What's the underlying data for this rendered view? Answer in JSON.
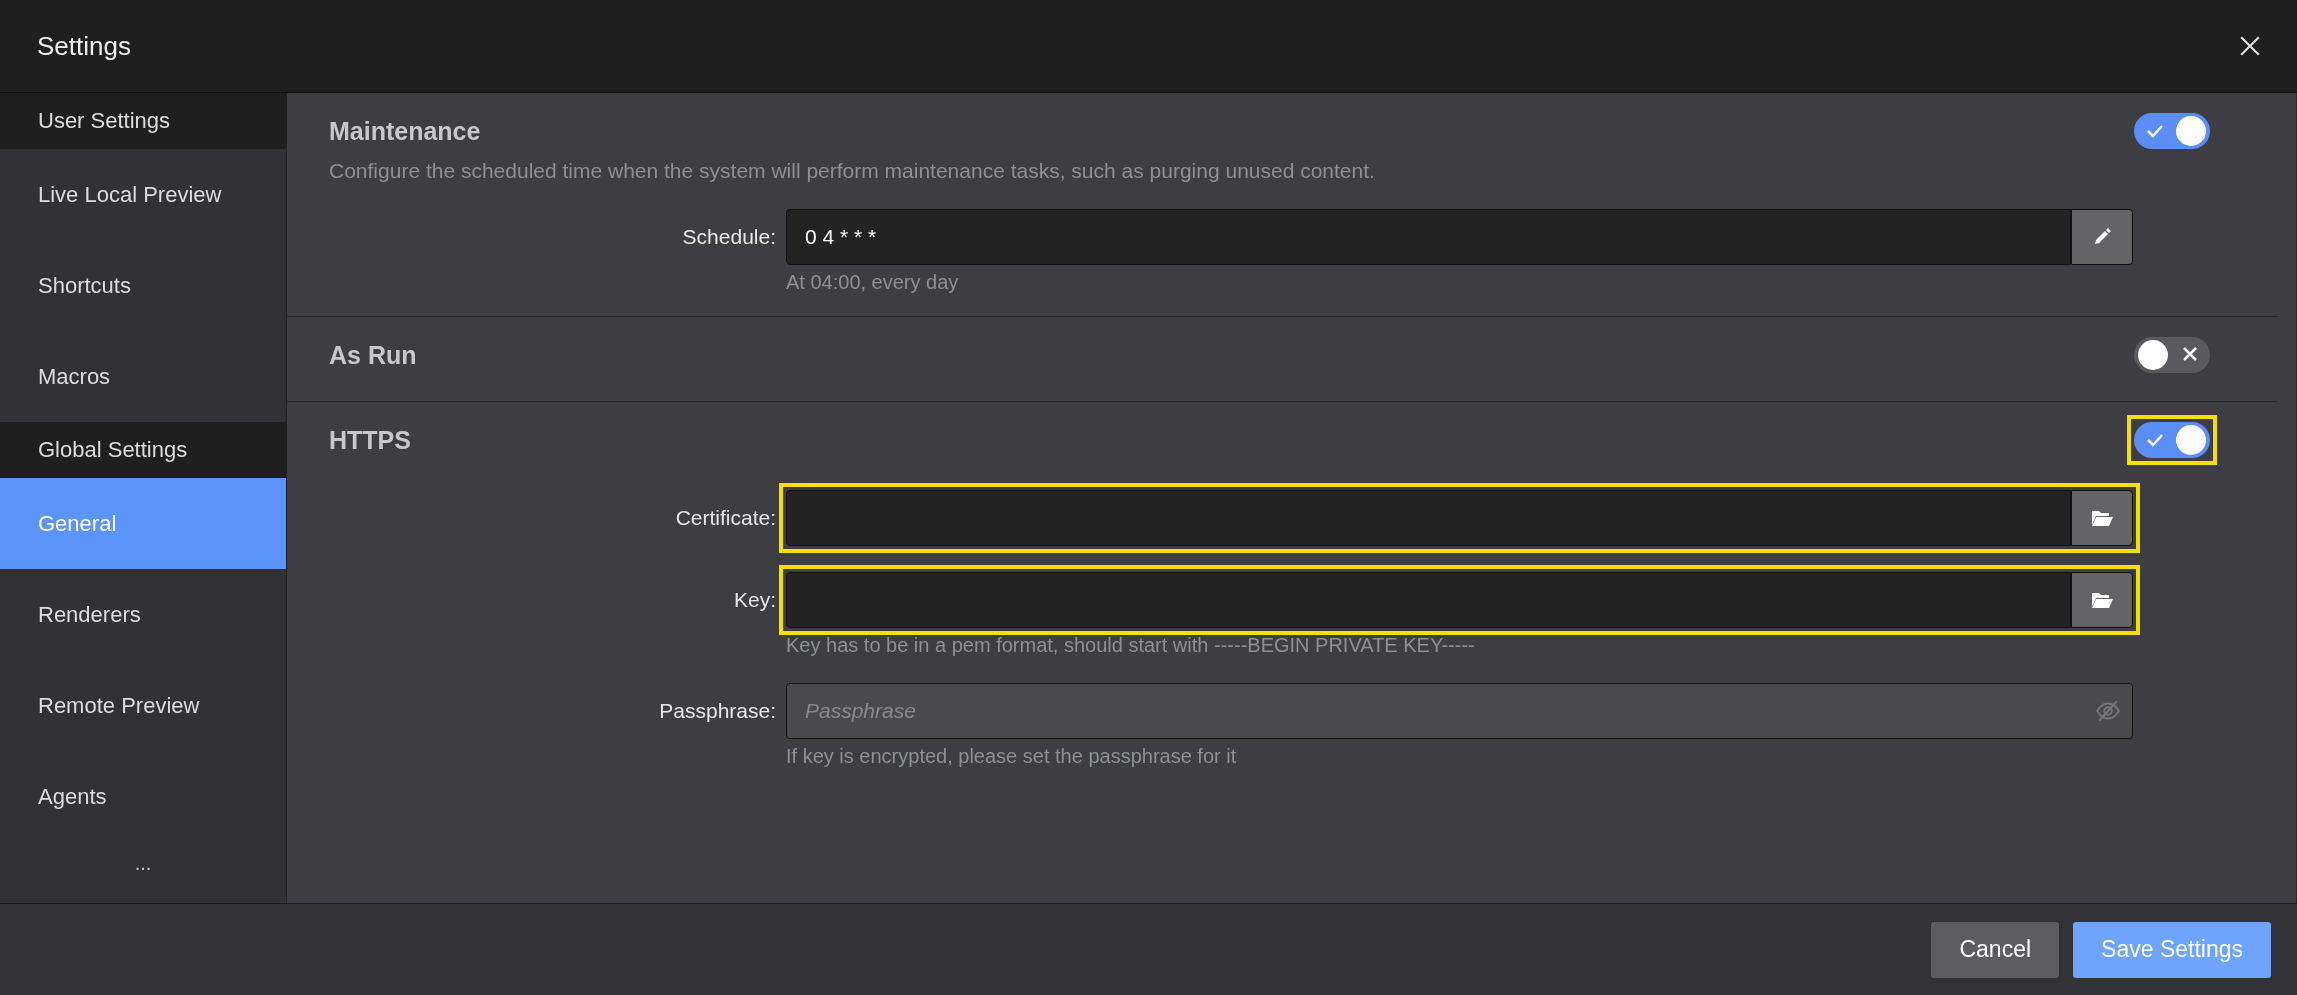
{
  "window": {
    "title": "Settings"
  },
  "sidebar": {
    "items": [
      {
        "kind": "group",
        "label": "User Settings"
      },
      {
        "kind": "item",
        "label": "Live Local Preview",
        "selected": false
      },
      {
        "kind": "item",
        "label": "Shortcuts",
        "selected": false
      },
      {
        "kind": "item",
        "label": "Macros",
        "selected": false
      },
      {
        "kind": "group",
        "label": "Global Settings"
      },
      {
        "kind": "item",
        "label": "General",
        "selected": true
      },
      {
        "kind": "item",
        "label": "Renderers",
        "selected": false
      },
      {
        "kind": "item",
        "label": "Remote Preview",
        "selected": false
      },
      {
        "kind": "item",
        "label": "Agents",
        "selected": false
      }
    ],
    "more": "..."
  },
  "sections": [
    {
      "title": "Maintenance",
      "on": true,
      "highlighted": false,
      "description": "Configure the scheduled time when the system will perform maintenance tasks, such as purging unused content.",
      "fields": [
        {
          "kind": "schedule",
          "label": "Schedule:",
          "value": "0 4 * * *",
          "highlighted": false,
          "hint": "At 04:00, every day"
        }
      ]
    },
    {
      "title": "As Run",
      "on": false,
      "highlighted": false
    },
    {
      "title": "HTTPS",
      "on": true,
      "highlighted": true,
      "fields": [
        {
          "kind": "file",
          "label": "Certificate:",
          "highlighted": true
        },
        {
          "kind": "file",
          "label": "Key:",
          "highlighted": true,
          "hint": "Key has to be in a pem format, should start with -----BEGIN PRIVATE KEY-----"
        },
        {
          "kind": "password",
          "label": "Passphrase:",
          "placeholder": "Passphrase",
          "highlighted": false,
          "hint": "If key is encrypted, please set the passphrase for it"
        }
      ]
    }
  ],
  "footer": {
    "buttons": [
      {
        "kind": "secondary",
        "label": "Cancel"
      },
      {
        "kind": "primary",
        "label": "Save Settings"
      }
    ]
  }
}
